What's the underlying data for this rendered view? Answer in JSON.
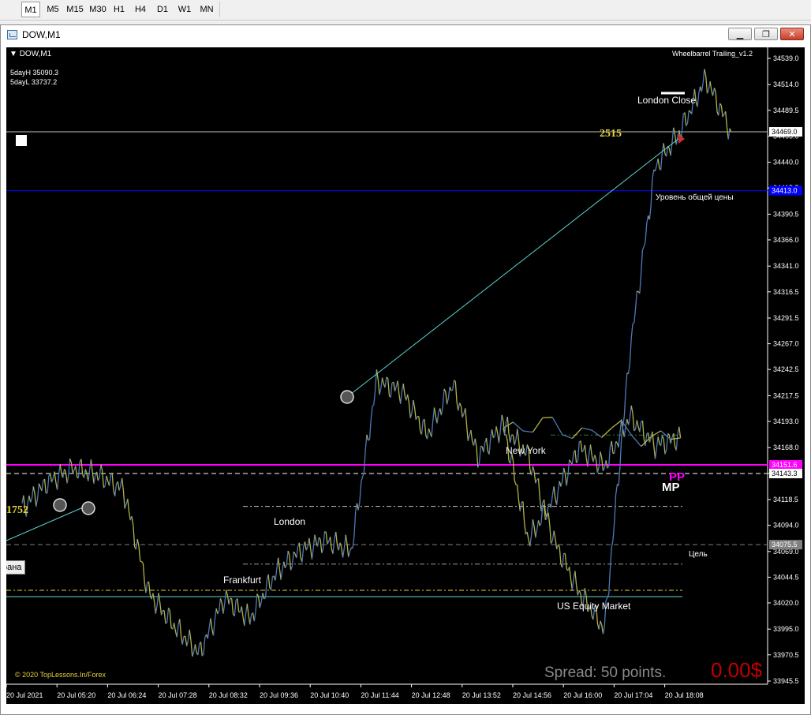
{
  "toolbar": {
    "timeframes": [
      {
        "label": "M1",
        "active": true
      },
      {
        "label": "M5",
        "active": false
      },
      {
        "label": "M15",
        "active": false
      },
      {
        "label": "M30",
        "active": false
      },
      {
        "label": "H1",
        "active": false
      },
      {
        "label": "H4",
        "active": false
      },
      {
        "label": "D1",
        "active": false
      },
      {
        "label": "W1",
        "active": false
      },
      {
        "label": "MN",
        "active": false
      }
    ]
  },
  "window": {
    "title": "DOW,M1",
    "icon": "chart-window-icon",
    "buttons": {
      "minimize": "minimize-icon",
      "restore": "restore-icon",
      "close": "close-icon"
    }
  },
  "chart": {
    "symbol_label": "DOW,M1",
    "indicator_name": "Wheelbarrel Trailing_v1.2",
    "info_lines": [
      "5dayH 35090.3",
      "5dayL 33737.2"
    ],
    "copyright": "© 2020 TopLessons.In/Forex",
    "spread_text": "Spread: 50 points.",
    "profit_text": "0.00$",
    "number_label_top": "2515",
    "number_label_left": "1752",
    "left_cut_label": "рана",
    "session_labels": {
      "london_close": "London Close",
      "new_york": "New York",
      "london": "London",
      "frankfurt": "Frankfurt",
      "us_equity": "US Equity Market"
    },
    "level_labels": {
      "common_price": "Уровень общей цены",
      "target": "Цель",
      "mp": "MP",
      "pp": "PP"
    },
    "price_tags": {
      "current": "34469.0",
      "blue_level": "34413.0",
      "magenta_level": "34151.6",
      "white_level": "34143.3",
      "target_level": "34075.5"
    },
    "colors": {
      "background": "#000000",
      "candles_up": "#4f79b8",
      "candles_down": "#b3b347",
      "bid_line": "#c0c0c0",
      "blue_level": "#0000ff",
      "magenta_level": "#ff00ff",
      "trend_line": "#5fd3d3",
      "spread_text": "#8a8a8a",
      "profit_text": "#c00000",
      "number_label": "#e6d23c"
    }
  },
  "chart_data": {
    "type": "line",
    "title": "",
    "xlabel": "",
    "ylabel": "",
    "ylim": [
      33945.5,
      34545.0
    ],
    "y_ticks": [
      34539.0,
      34514.0,
      34489.5,
      34465.0,
      34440.0,
      34415.5,
      34390.5,
      34366.0,
      34341.0,
      34316.5,
      34291.5,
      34267.0,
      34242.5,
      34217.5,
      34193.0,
      34168.0,
      34143.5,
      34118.5,
      34094.0,
      34069.0,
      34044.5,
      34020.0,
      33995.0,
      33970.5,
      33945.5
    ],
    "x_ticks": [
      "20 Jul 2021",
      "20 Jul 05:20",
      "20 Jul 06:24",
      "20 Jul 07:28",
      "20 Jul 08:32",
      "20 Jul 09:36",
      "20 Jul 10:40",
      "20 Jul 11:44",
      "20 Jul 12:48",
      "20 Jul 13:52",
      "20 Jul 14:56",
      "20 Jul 16:00",
      "20 Jul 17:04",
      "20 Jul 18:08"
    ],
    "series": [
      {
        "x": [
          0.0,
          0.5,
          1.0,
          1.5,
          2.0,
          2.5,
          3.0,
          3.5,
          4.0,
          4.5,
          5.0,
          5.5,
          6.0,
          6.5,
          7.0,
          7.5,
          8.0,
          8.5,
          9.0,
          9.5,
          10.0,
          10.5,
          11.0,
          11.5,
          12.0,
          12.5,
          13.0
        ],
        "values": [
          34110,
          34135,
          34148,
          34142,
          34128,
          34030,
          33998,
          33972,
          34025,
          34005,
          34048,
          34070,
          34080,
          34070,
          34231,
          34222,
          34180,
          34228,
          34160,
          34190,
          34080,
          34120,
          34168,
          34150,
          34198,
          34170,
          34178
        ]
      }
    ],
    "x_values_by_tick": [
      0.0,
      1.0,
      2.0,
      3.0,
      4.0,
      5.0,
      6.0,
      7.0,
      8.0,
      9.0,
      10.0,
      11.0,
      12.0,
      13.0
    ],
    "x_values_late": [
      9.5,
      10.0,
      10.5,
      11.0,
      11.5,
      12.0,
      12.5,
      13.0,
      13.5,
      14.0
    ],
    "values_late": [
      34190,
      34160,
      34080,
      34030,
      33995,
      34260,
      34435,
      34470,
      34520,
      34469
    ],
    "horizontal_levels": [
      {
        "value": 34469.0,
        "style": "solid",
        "color": "#c0c0c0"
      },
      {
        "value": 34413.0,
        "style": "solid",
        "color": "#0000ff"
      },
      {
        "value": 34151.6,
        "style": "solid",
        "color": "#ff00ff"
      },
      {
        "value": 34143.3,
        "style": "dashed",
        "color": "#ffffff"
      },
      {
        "value": 34075.5,
        "style": "dashed",
        "color": "#808080"
      }
    ]
  }
}
